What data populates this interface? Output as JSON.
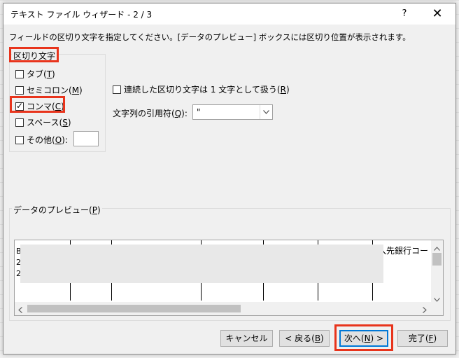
{
  "dialog": {
    "title": "テキスト ファイル ウィザード - 2 / 3",
    "help": "?",
    "close": "✕",
    "instruction": "フィールドの区切り文字を指定してください。[データのプレビュー] ボックスには区切り位置が表示されます。"
  },
  "delimiters": {
    "group_label": "区切り文字",
    "tab": {
      "text": "タブ(",
      "key": "T",
      "end": ")"
    },
    "semicolon": {
      "text": "セミコロン(",
      "key": "M",
      "end": ")"
    },
    "comma": {
      "text": "コンマ(",
      "key": "C",
      "end": ")"
    },
    "space": {
      "text": "スペース(",
      "key": "S",
      "end": ")"
    },
    "other": {
      "text": "その他(",
      "key": "O",
      "end": "):"
    },
    "other_value": ""
  },
  "options": {
    "consecutive": {
      "text": "連続した区切り文字は 1 文字として扱う(",
      "key": "R",
      "end": ")"
    },
    "qualifier_label": {
      "text": "文字列の引用符(",
      "key": "Q",
      "end": "):"
    },
    "qualifier_value": "\""
  },
  "preview": {
    "label": {
      "text": "データのプレビュー(",
      "key": "P",
      "end": ")"
    },
    "row1_first": "B",
    "row2_first": "2",
    "row3_first": "2",
    "row1_tail": "入先銀行コー"
  },
  "buttons": {
    "cancel": "キャンセル",
    "back": {
      "text": "< 戻る(",
      "key": "B",
      "end": ")"
    },
    "next": {
      "text": "次へ(",
      "key": "N",
      "end": ") >"
    },
    "finish": {
      "text": "完了(",
      "key": "F",
      "end": ")"
    }
  },
  "state": {
    "tab_checked": false,
    "semicolon_checked": false,
    "comma_checked": true,
    "space_checked": false,
    "other_checked": false,
    "consecutive_checked": false
  },
  "colors": {
    "highlight": "#e8341c",
    "default_button_border": "#0078d7"
  }
}
